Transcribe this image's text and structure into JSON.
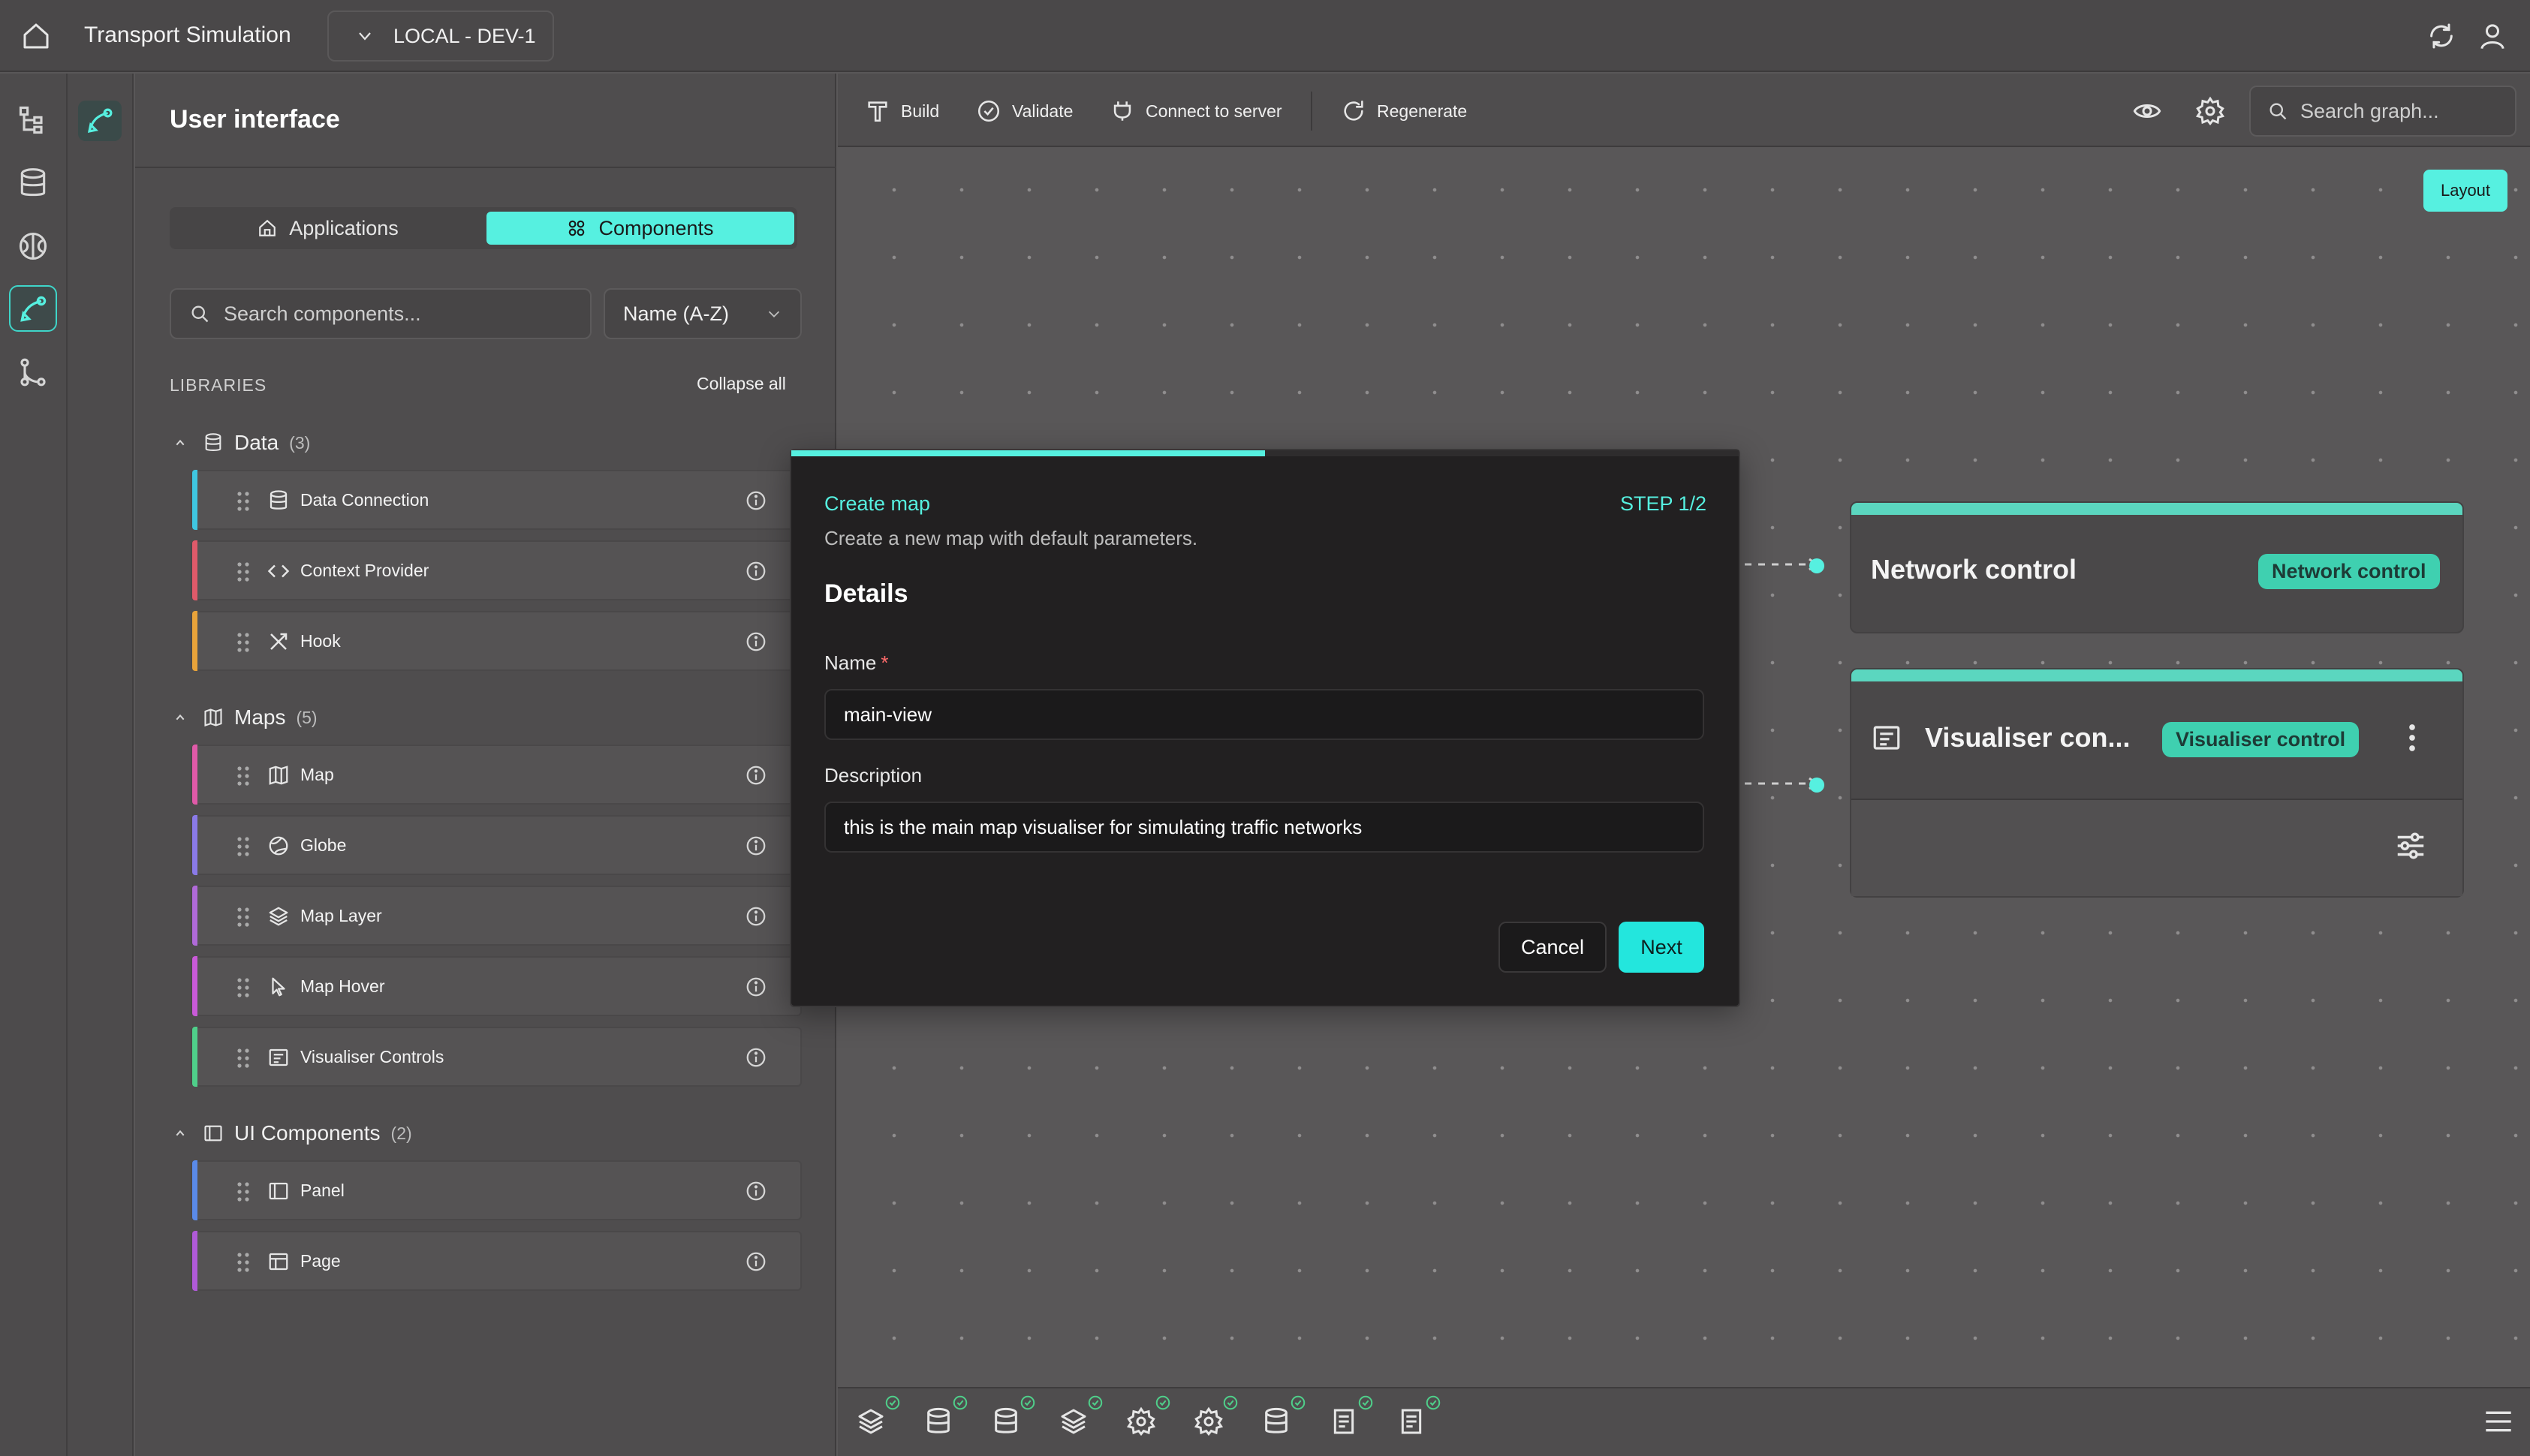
{
  "app": {
    "title": "Transport Simulation",
    "environment": "LOCAL - DEV-1"
  },
  "rail": {
    "icons": [
      "tree-icon",
      "database-icon",
      "brain-icon",
      "ui-icon",
      "git-branch-icon"
    ],
    "active": "ui-icon"
  },
  "panel": {
    "title": "User interface",
    "tabs": [
      {
        "label": "Applications",
        "icon": "home-icon",
        "selected": false
      },
      {
        "label": "Components",
        "icon": "grid-icon",
        "selected": true
      }
    ],
    "search_placeholder": "Search components...",
    "sort_value": "Name (A-Z)",
    "libraries_label": "LIBRARIES",
    "collapse_all": "Collapse all",
    "groups": [
      {
        "name": "Data",
        "count": "(3)",
        "icon": "database-icon",
        "items": [
          {
            "label": "Data Connection",
            "icon": "database-icon",
            "accent": "#3fc6e0"
          },
          {
            "label": "Context Provider",
            "icon": "code-icon",
            "accent": "#e05a6a"
          },
          {
            "label": "Hook",
            "icon": "tools-icon",
            "accent": "#e8a33a"
          }
        ]
      },
      {
        "name": "Maps",
        "count": "(5)",
        "icon": "map-icon",
        "items": [
          {
            "label": "Map",
            "icon": "map-icon",
            "accent": "#e05aa8"
          },
          {
            "label": "Globe",
            "icon": "globe-icon",
            "accent": "#8a7ae8"
          },
          {
            "label": "Map Layer",
            "icon": "layers-icon",
            "accent": "#b06ad8"
          },
          {
            "label": "Map Hover",
            "icon": "cursor-icon",
            "accent": "#c95ad8"
          },
          {
            "label": "Visualiser Controls",
            "icon": "controls-icon",
            "accent": "#4fcf8a"
          }
        ]
      },
      {
        "name": "UI Components",
        "count": "(2)",
        "icon": "panel-icon",
        "items": [
          {
            "label": "Panel",
            "icon": "panel-icon",
            "accent": "#5a8ae8"
          },
          {
            "label": "Page",
            "icon": "page-icon",
            "accent": "#b05ad8"
          }
        ]
      }
    ]
  },
  "toolbar": {
    "build": "Build",
    "validate": "Validate",
    "connect": "Connect to server",
    "regenerate": "Regenerate",
    "search_placeholder": "Search graph..."
  },
  "canvas": {
    "layout_button": "Layout",
    "nodes": [
      {
        "title": "Network control",
        "tag": "Network control"
      },
      {
        "title": "Visualiser con...",
        "tag": "Visualiser control"
      }
    ]
  },
  "bottombar": {
    "icons": [
      "layers-icon",
      "database-icon",
      "database-icon",
      "layers-icon",
      "gear-icon",
      "gear-icon",
      "database-icon",
      "document-icon",
      "document-icon"
    ]
  },
  "modal": {
    "eyebrow": "Create map",
    "step": "STEP 1/2",
    "progress": 0.5,
    "subtitle": "Create a new map with default parameters.",
    "heading": "Details",
    "name_label": "Name",
    "name_required": "*",
    "name_value": "main-view",
    "description_label": "Description",
    "description_value": "this is the main map visualiser for simulating traffic networks",
    "cancel": "Cancel",
    "next": "Next"
  },
  "colors": {
    "accent": "#56f0e0",
    "node_tag": "#3fd0b0",
    "background": "#595758"
  }
}
